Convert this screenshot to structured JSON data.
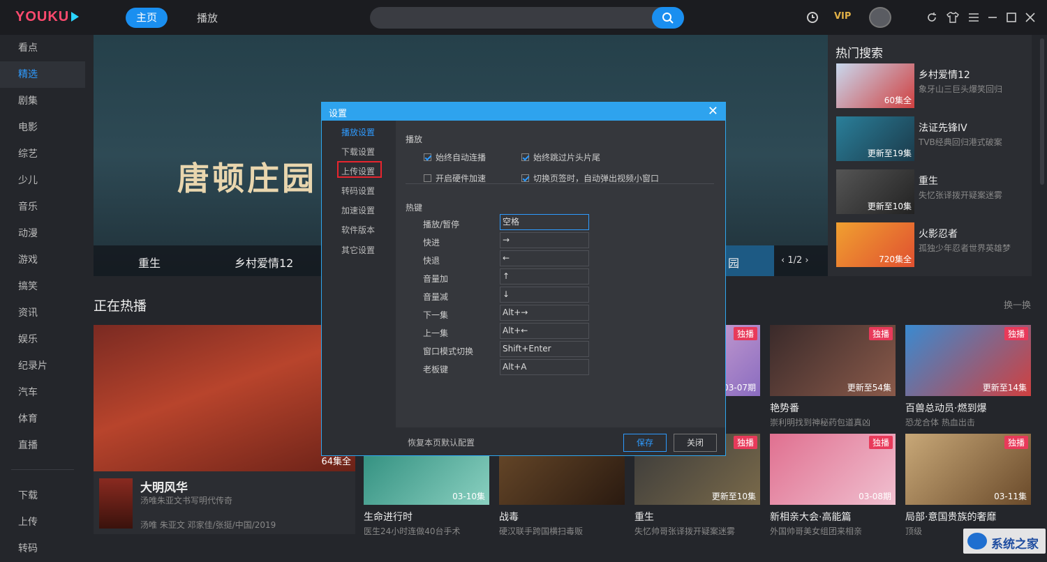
{
  "topbar": {
    "logo": "YOUKU",
    "nav_home": "主页",
    "nav_play": "播放",
    "vip": "VIP"
  },
  "sidebar": {
    "items": [
      "看点",
      "精选",
      "剧集",
      "电影",
      "综艺",
      "少儿",
      "音乐",
      "动漫",
      "游戏",
      "搞笑",
      "资讯",
      "娱乐",
      "纪录片",
      "汽车",
      "体育",
      "直播"
    ],
    "active_index": 1,
    "bottom_items": [
      "下载",
      "上传",
      "转码"
    ]
  },
  "banner": {
    "title": "唐顿庄园",
    "strip": [
      "重生",
      "乡村爱情12"
    ],
    "active_tail": "园",
    "pager": "1/2"
  },
  "hot_search": {
    "title": "热门搜索",
    "items": [
      {
        "name": "乡村爱情12",
        "desc": "象牙山三巨头爆笑回归",
        "badge": "60集全"
      },
      {
        "name": "法证先锋IV",
        "desc": "TVB经典回归港式破案",
        "badge": "更新至19集"
      },
      {
        "name": "重生",
        "desc": "失忆张译拨开疑案迷雾",
        "badge": "更新至10集"
      },
      {
        "name": "火影忍者",
        "desc": "孤独少年忍者世界英雄梦",
        "badge": "720集全"
      }
    ]
  },
  "section": {
    "title": "正在热播",
    "swap": "换一换"
  },
  "featured": {
    "name": "大明风华",
    "desc": "汤唯朱亚文书写明代传奇",
    "meta": "汤唯 朱亚文 邓家佳/张挺/中国/2019",
    "badge": "64集全"
  },
  "cards_row1": [
    {
      "name": "",
      "desc": "",
      "badge": "03-07期",
      "exclusive": "独播"
    },
    {
      "name": "艳势番",
      "desc": "崇利明找到神秘药包道真凶",
      "badge": "更新至54集",
      "exclusive": "独播"
    },
    {
      "name": "百兽总动员·燃到爆",
      "desc": "恐龙合体 热血出击",
      "badge": "更新至14集",
      "exclusive": "独播"
    }
  ],
  "cards_row2": [
    {
      "name": "生命进行时",
      "desc": "医生24小时连做40台手术",
      "badge": "03-10集",
      "exclusive": ""
    },
    {
      "name": "战毒",
      "desc": "硬汉联手跨国横扫毒贩",
      "badge": "",
      "exclusive": ""
    },
    {
      "name": "重生",
      "desc": "失忆帅哥张译拨开疑案迷雾",
      "badge": "更新至10集",
      "exclusive": "独播"
    },
    {
      "name": "新相亲大会·高能篇",
      "desc": "外国帅哥美女组团来相亲",
      "badge": "03-08期",
      "exclusive": "独播"
    },
    {
      "name": "局部·意国贵族的奢靡",
      "desc": "顶级",
      "badge": "03-11集",
      "exclusive": "独播"
    }
  ],
  "watermark": "系统之家",
  "dialog": {
    "title": "设置",
    "close": "✕",
    "nav": [
      "播放设置",
      "下载设置",
      "上传设置",
      "转码设置",
      "加速设置",
      "软件版本",
      "其它设置"
    ],
    "nav_active": 0,
    "play_group": "播放",
    "options": [
      {
        "label": "始终自动连播",
        "checked": true
      },
      {
        "label": "始终跳过片头片尾",
        "checked": true
      },
      {
        "label": "开启硬件加速",
        "checked": false
      },
      {
        "label": "切换页签时，自动弹出视频小窗口",
        "checked": true
      }
    ],
    "hotkey_group": "热键",
    "hotkeys": [
      {
        "label": "播放/暂停",
        "value": "空格"
      },
      {
        "label": "快进",
        "value": "→"
      },
      {
        "label": "快退",
        "value": "←"
      },
      {
        "label": "音量加",
        "value": "↑"
      },
      {
        "label": "音量减",
        "value": "↓"
      },
      {
        "label": "下一集",
        "value": "Alt+→"
      },
      {
        "label": "上一集",
        "value": "Alt+←"
      },
      {
        "label": "窗口模式切换",
        "value": "Shift+Enter"
      },
      {
        "label": "老板键",
        "value": "Alt+A"
      }
    ],
    "restore": "恢复本页默认配置",
    "save": "保存",
    "cancel": "关闭"
  },
  "colors": {
    "accent": "#1a8ff0",
    "vip": "#e0b047",
    "exclusive": "#e83a5a",
    "dialog_header": "#2ea3ee"
  }
}
